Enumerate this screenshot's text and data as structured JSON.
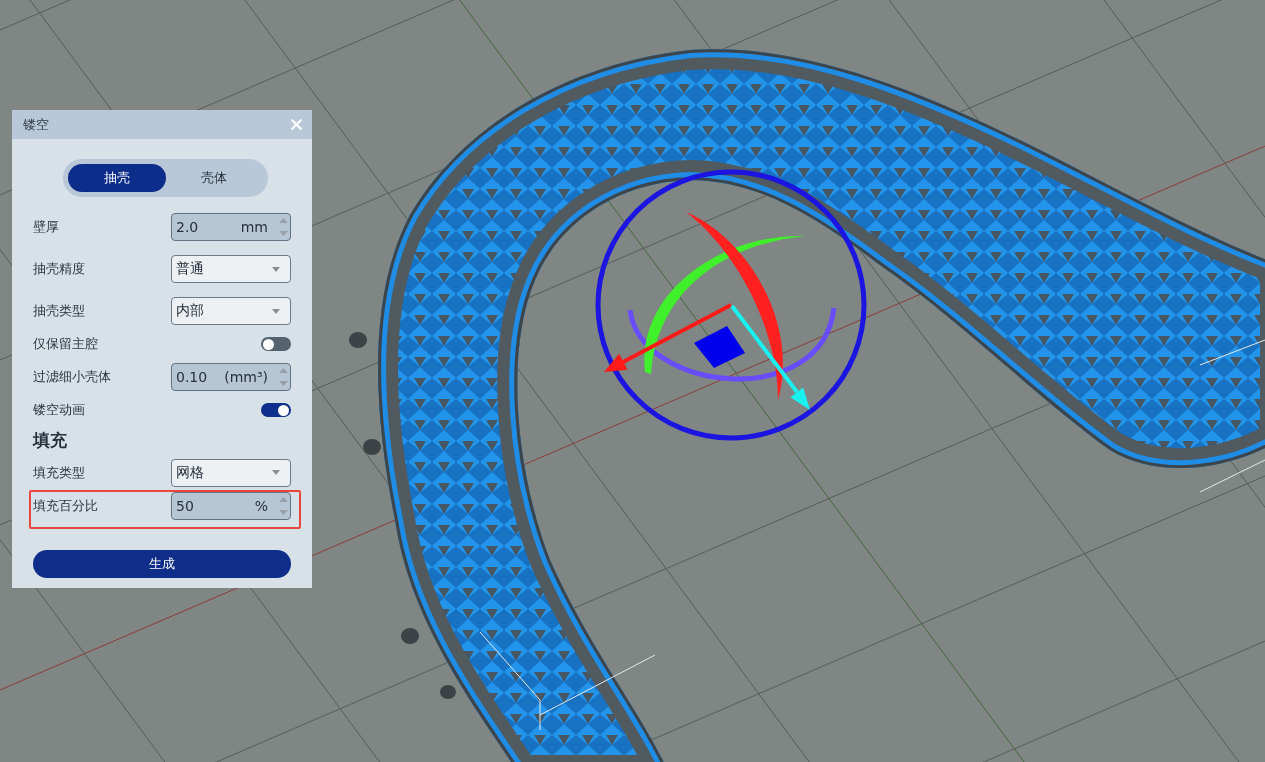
{
  "panel": {
    "title": "镂空",
    "mode_tabs": [
      {
        "label": "抽壳",
        "selected": true
      },
      {
        "label": "壳体",
        "selected": false
      }
    ],
    "fields": [
      {
        "kind": "spinbox",
        "label": "壁厚",
        "value": "2.0",
        "unit": "mm",
        "highlighted": false
      },
      {
        "kind": "dropdown",
        "label": "抽壳精度",
        "value": "普通",
        "highlighted": false
      },
      {
        "kind": "dropdown",
        "label": "抽壳类型",
        "value": "内部",
        "highlighted": false
      },
      {
        "kind": "toggle",
        "label": "仅保留主腔",
        "on": false,
        "highlighted": false
      },
      {
        "kind": "spinbox",
        "label": "过滤细小壳体",
        "value": "0.10",
        "unit": "(mm³)",
        "highlighted": false
      },
      {
        "kind": "toggle",
        "label": "镂空动画",
        "on": true,
        "highlighted": false
      }
    ],
    "fill_section": {
      "heading": "填充",
      "fields": [
        {
          "kind": "dropdown",
          "label": "填充类型",
          "value": "网格",
          "highlighted": false
        },
        {
          "kind": "spinbox",
          "label": "填充百分比",
          "value": "50",
          "unit": "%",
          "highlighted": true
        }
      ]
    },
    "generate_button": "生成"
  }
}
